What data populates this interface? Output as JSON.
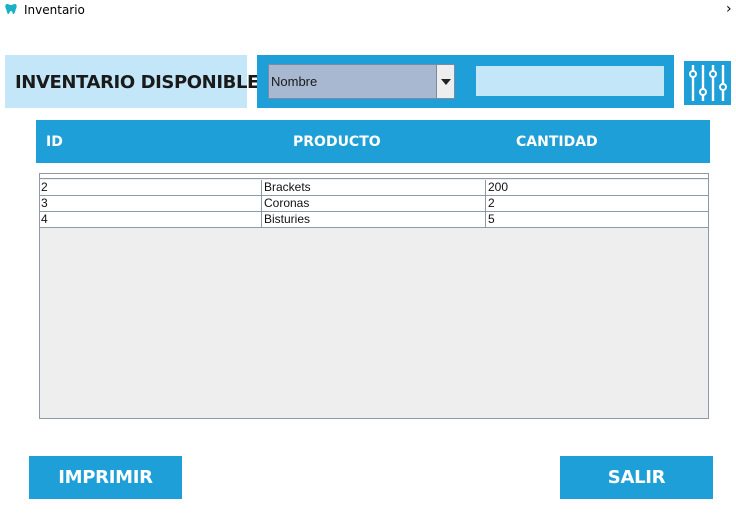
{
  "window": {
    "title": "Inventario",
    "arrow": "›"
  },
  "header": {
    "title": "INVENTARIO DISPONIBLE"
  },
  "search": {
    "field_selected": "Nombre",
    "query": "",
    "filter_icon": "sliders-icon"
  },
  "table": {
    "columns": [
      "ID",
      "PRODUCTO",
      "CANTIDAD"
    ],
    "rows": [
      {
        "id": "2",
        "producto": "Brackets",
        "cantidad": "200"
      },
      {
        "id": "3",
        "producto": "Coronas",
        "cantidad": "2"
      },
      {
        "id": "4",
        "producto": "Bisturies",
        "cantidad": "5"
      }
    ]
  },
  "actions": {
    "print_label": "IMPRIMIR",
    "exit_label": "SALIR"
  },
  "colors": {
    "accent": "#1e9fd8",
    "light_accent": "#c3e6f9",
    "combo_bg": "#a7b8d0",
    "table_bg": "#eeeeee"
  }
}
